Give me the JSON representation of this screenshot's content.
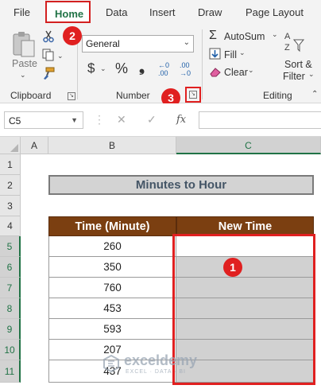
{
  "menu": {
    "file": "File",
    "home": "Home",
    "data": "Data",
    "insert": "Insert",
    "draw": "Draw",
    "page_layout": "Page Layout"
  },
  "ribbon": {
    "clipboard": {
      "paste": "Paste",
      "label": "Clipboard"
    },
    "number": {
      "format": "General",
      "label": "Number",
      "currency": "$",
      "percent": "%",
      "comma": "❟",
      "inc_decimal": "←0 .00",
      "dec_decimal": ".00 →0"
    },
    "editing": {
      "autosum": "AutoSum",
      "fill": "Fill",
      "clear": "Clear",
      "sort_filter_line1": "Sort &",
      "sort_filter_line2": "Filter",
      "label": "Editing"
    }
  },
  "badges": {
    "one": "1",
    "two": "2",
    "three": "3"
  },
  "formula_bar": {
    "name_box": "C5",
    "cancel": "✕",
    "enter": "✓",
    "fx": "fx",
    "value": ""
  },
  "columns": [
    "A",
    "B",
    "C"
  ],
  "rows": [
    "1",
    "2",
    "3",
    "4",
    "5",
    "6",
    "7",
    "8",
    "9",
    "10",
    "11"
  ],
  "sheet": {
    "title": "Minutes to Hour",
    "headers": [
      "Time (Minute)",
      "New Time"
    ],
    "minutes": [
      "260",
      "350",
      "760",
      "453",
      "593",
      "207",
      "437"
    ]
  },
  "watermark": {
    "name": "exceldemy",
    "tagline": "EXCEL · DATA · BI"
  },
  "colors": {
    "accent": "#217346",
    "highlight": "#e02020",
    "header_fill": "#7b3f11",
    "selected_fill": "#d1d1d1"
  }
}
